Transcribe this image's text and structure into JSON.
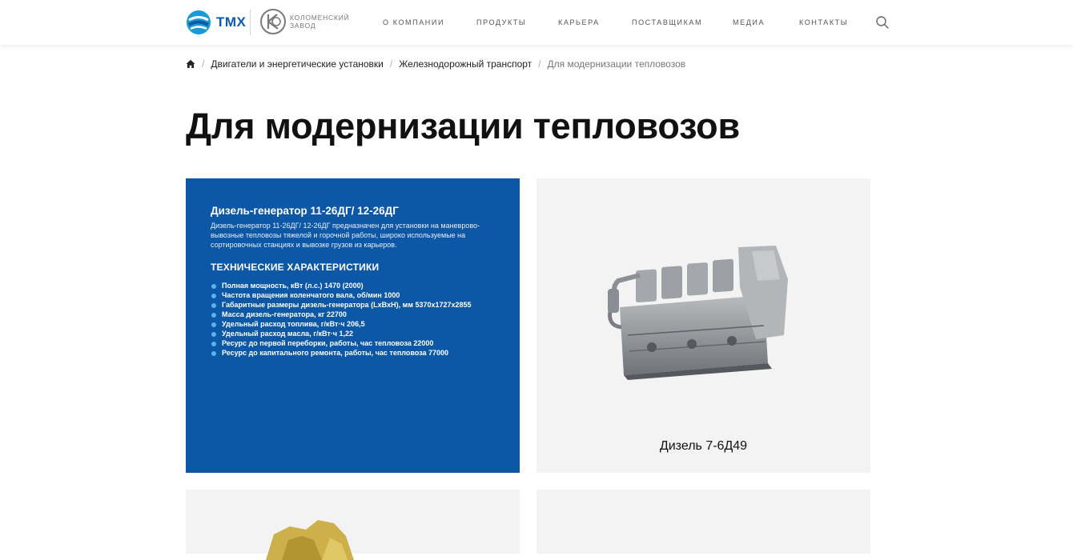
{
  "header": {
    "logo_tmx_text": "ТМХ",
    "logo_kz_line1": "Коломенский",
    "logo_kz_line2": "завод",
    "nav": [
      "О КОМПАНИИ",
      "ПРОДУКТЫ",
      "КАРЬЕРА",
      "ПОСТАВЩИКАМ",
      "МЕДИА",
      "КОНТАКТЫ"
    ],
    "search_icon": "search-icon"
  },
  "breadcrumb": {
    "home_icon": "home-icon",
    "items": [
      "Двигатели и энергетические установки",
      "Железнодорожный транспорт"
    ],
    "current": "Для модернизации тепловозов"
  },
  "page_title": "Для модернизации тепловозов",
  "info_card": {
    "title": "Дизель-генератор 11-26ДГ/ 12-26ДГ",
    "description": "Дизель-генератор 11-26ДГ/ 12-26ДГ предназначен для установки на маневрово-вывозные тепловозы тяжелой и горочной работы, широко используемые на сортировочных станциях и вывозке грузов из карьеров.",
    "spec_title": "ТЕХНИЧЕСКИЕ ХАРАКТЕРИСТИКИ",
    "specs": [
      "Полная мощность, кВт (л.с.) 1470 (2000)",
      "Частота вращения коленчатого вала, об/мин 1000",
      "Габаритные размеры дизель-генератора (LxBxH), мм 5370х1727х2855",
      "Масса дизель-генератора, кг 22700",
      "Удельный расход топлива, г/кВт·ч 206,5",
      "Удельный расход масла, г/кВт·ч 1,22",
      "Ресурс до первой переборки, работы, час тепловоза 22000",
      "Ресурс до капитального ремонта, работы, час тепловоза 77000"
    ]
  },
  "product_card": {
    "name": "Дизель 7-6Д49"
  },
  "colors": {
    "brand_blue": "#0d58a6",
    "bullet": "#55b4ea",
    "card_gray": "#f3f3f3"
  }
}
